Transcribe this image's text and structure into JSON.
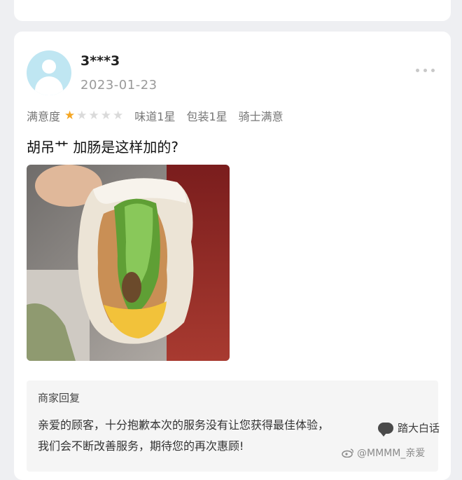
{
  "review": {
    "username": "3***3",
    "date": "2023-01-23",
    "satisfaction_label": "满意度",
    "stars": {
      "filled": 1,
      "total": 5
    },
    "tags": [
      "味道1星",
      "包装1星",
      "骑士满意"
    ],
    "text": "胡吊艹  加肠是这样加的?"
  },
  "merchant_reply": {
    "title": "商家回复",
    "lines": [
      "亲爱的顾客，十分抱歉本次的服务没有让您获得最佳体验，",
      "我们会不断改善服务，期待您的再次惠顾!"
    ]
  },
  "watermarks": {
    "channel": "踏大白话",
    "weibo_handle": "@MMMM_亲爱"
  },
  "colors": {
    "star_on": "#f5a623",
    "star_off": "#dadada",
    "avatar_bg": "#bfe6f2"
  },
  "icons": [
    "avatar-placeholder-icon",
    "more-icon",
    "star-icon",
    "wechat-icon",
    "weibo-icon"
  ]
}
